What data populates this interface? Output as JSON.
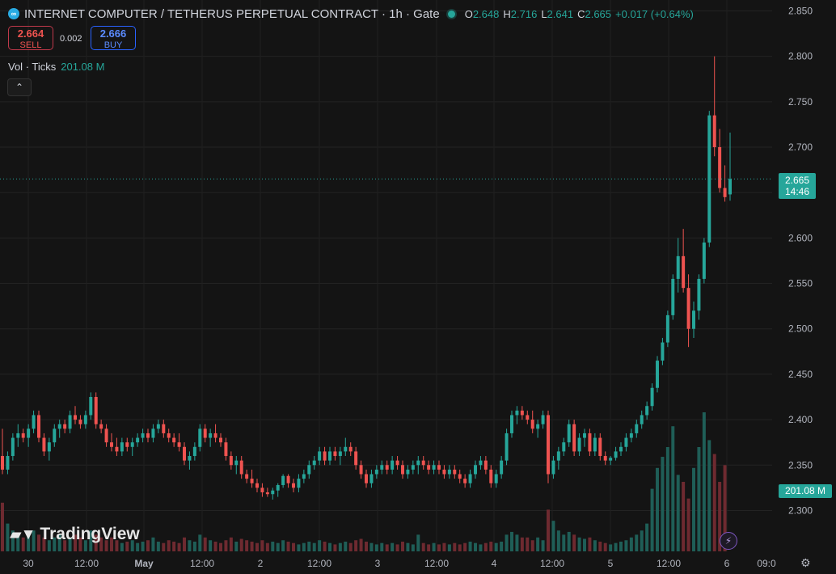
{
  "header": {
    "symbol_icon": "infinity-icon",
    "title": "INTERNET COMPUTER / TETHERUS PERPETUAL CONTRACT · 1h · Gate",
    "ohlc": [
      {
        "k": "O",
        "v": "2.648"
      },
      {
        "k": "H",
        "v": "2.716"
      },
      {
        "k": "L",
        "v": "2.641"
      },
      {
        "k": "C",
        "v": "2.665"
      },
      {
        "k": "",
        "v": "+0.017 (+0.64%)"
      }
    ]
  },
  "trade": {
    "sell_price": "2.664",
    "sell_label": "SELL",
    "spread": "0.002",
    "buy_price": "2.666",
    "buy_label": "BUY"
  },
  "volume_legend": {
    "label": "Vol · Ticks",
    "value": "201.08 M"
  },
  "collapse_icon": "chevron-up-icon",
  "price_label": {
    "price": "2.665",
    "countdown": "14:46"
  },
  "volume_label": "201.08 M",
  "brand": "TradingView",
  "colors": {
    "up": "#26a69a",
    "down": "#ef5350",
    "vol_up": "#1f5e57",
    "vol_down": "#6e2a30",
    "background": "#141414"
  },
  "chart_data": {
    "type": "candlestick",
    "title": "INTERNET COMPUTER / TETHERUS PERPETUAL CONTRACT · 1h · Gate",
    "y_ticks": [
      "2.850",
      "2.800",
      "2.750",
      "2.700",
      "2.650",
      "2.600",
      "2.550",
      "2.500",
      "2.450",
      "2.400",
      "2.350",
      "2.300"
    ],
    "y_range": [
      2.255,
      2.862
    ],
    "x_ticks": [
      "30",
      "12:00",
      "May",
      "12:00",
      "2",
      "12:00",
      "3",
      "12:00",
      "4",
      "12:00",
      "5",
      "12:00",
      "6",
      "09:0"
    ],
    "current_price": 2.665,
    "grid": true,
    "series": [
      {
        "name": "Vol · Ticks",
        "type": "histogram",
        "last_value": "201.08 M"
      }
    ],
    "bars": [
      [
        2.36,
        2.39,
        2.34,
        2.345
      ],
      [
        2.345,
        2.365,
        2.34,
        2.36
      ],
      [
        2.36,
        2.385,
        2.355,
        2.38
      ],
      [
        2.38,
        2.395,
        2.37,
        2.385
      ],
      [
        2.385,
        2.39,
        2.375,
        2.38
      ],
      [
        2.38,
        2.395,
        2.37,
        2.39
      ],
      [
        2.39,
        2.41,
        2.385,
        2.405
      ],
      [
        2.405,
        2.41,
        2.375,
        2.38
      ],
      [
        2.38,
        2.385,
        2.36,
        2.365
      ],
      [
        2.365,
        2.38,
        2.355,
        2.375
      ],
      [
        2.375,
        2.395,
        2.37,
        2.39
      ],
      [
        2.39,
        2.4,
        2.38,
        2.395
      ],
      [
        2.395,
        2.4,
        2.385,
        2.39
      ],
      [
        2.39,
        2.41,
        2.385,
        2.405
      ],
      [
        2.405,
        2.415,
        2.395,
        2.4
      ],
      [
        2.4,
        2.405,
        2.39,
        2.395
      ],
      [
        2.395,
        2.41,
        2.39,
        2.405
      ],
      [
        2.405,
        2.43,
        2.4,
        2.425
      ],
      [
        2.425,
        2.43,
        2.39,
        2.395
      ],
      [
        2.395,
        2.4,
        2.385,
        2.39
      ],
      [
        2.39,
        2.395,
        2.37,
        2.375
      ],
      [
        2.375,
        2.385,
        2.365,
        2.37
      ],
      [
        2.37,
        2.38,
        2.36,
        2.365
      ],
      [
        2.365,
        2.38,
        2.36,
        2.375
      ],
      [
        2.375,
        2.38,
        2.365,
        2.37
      ],
      [
        2.37,
        2.38,
        2.36,
        2.375
      ],
      [
        2.375,
        2.385,
        2.37,
        2.38
      ],
      [
        2.38,
        2.39,
        2.375,
        2.385
      ],
      [
        2.385,
        2.39,
        2.375,
        2.38
      ],
      [
        2.38,
        2.395,
        2.375,
        2.39
      ],
      [
        2.39,
        2.4,
        2.385,
        2.395
      ],
      [
        2.395,
        2.4,
        2.38,
        2.385
      ],
      [
        2.385,
        2.39,
        2.375,
        2.38
      ],
      [
        2.38,
        2.385,
        2.37,
        2.375
      ],
      [
        2.375,
        2.385,
        2.365,
        2.37
      ],
      [
        2.37,
        2.375,
        2.35,
        2.355
      ],
      [
        2.355,
        2.365,
        2.345,
        2.36
      ],
      [
        2.36,
        2.375,
        2.355,
        2.37
      ],
      [
        2.37,
        2.395,
        2.365,
        2.39
      ],
      [
        2.39,
        2.395,
        2.375,
        2.38
      ],
      [
        2.38,
        2.39,
        2.37,
        2.385
      ],
      [
        2.385,
        2.395,
        2.375,
        2.38
      ],
      [
        2.38,
        2.385,
        2.37,
        2.375
      ],
      [
        2.375,
        2.38,
        2.355,
        2.36
      ],
      [
        2.36,
        2.365,
        2.345,
        2.35
      ],
      [
        2.35,
        2.36,
        2.34,
        2.355
      ],
      [
        2.355,
        2.36,
        2.335,
        2.34
      ],
      [
        2.34,
        2.345,
        2.33,
        2.335
      ],
      [
        2.335,
        2.345,
        2.325,
        2.33
      ],
      [
        2.33,
        2.335,
        2.32,
        2.325
      ],
      [
        2.325,
        2.33,
        2.315,
        2.32
      ],
      [
        2.32,
        2.325,
        2.315,
        2.318
      ],
      [
        2.318,
        2.325,
        2.312,
        2.322
      ],
      [
        2.322,
        2.33,
        2.315,
        2.328
      ],
      [
        2.328,
        2.34,
        2.325,
        2.338
      ],
      [
        2.338,
        2.34,
        2.325,
        2.33
      ],
      [
        2.33,
        2.335,
        2.32,
        2.325
      ],
      [
        2.325,
        2.34,
        2.32,
        2.335
      ],
      [
        2.335,
        2.345,
        2.33,
        2.34
      ],
      [
        2.34,
        2.355,
        2.335,
        2.35
      ],
      [
        2.35,
        2.36,
        2.345,
        2.355
      ],
      [
        2.355,
        2.37,
        2.35,
        2.365
      ],
      [
        2.365,
        2.37,
        2.35,
        2.355
      ],
      [
        2.355,
        2.37,
        2.35,
        2.365
      ],
      [
        2.365,
        2.37,
        2.355,
        2.36
      ],
      [
        2.36,
        2.37,
        2.35,
        2.365
      ],
      [
        2.365,
        2.38,
        2.36,
        2.37
      ],
      [
        2.37,
        2.375,
        2.36,
        2.365
      ],
      [
        2.365,
        2.37,
        2.345,
        2.35
      ],
      [
        2.35,
        2.355,
        2.335,
        2.34
      ],
      [
        2.34,
        2.345,
        2.325,
        2.33
      ],
      [
        2.33,
        2.345,
        2.325,
        2.34
      ],
      [
        2.34,
        2.35,
        2.335,
        2.345
      ],
      [
        2.345,
        2.355,
        2.34,
        2.35
      ],
      [
        2.35,
        2.355,
        2.34,
        2.345
      ],
      [
        2.345,
        2.36,
        2.34,
        2.355
      ],
      [
        2.355,
        2.36,
        2.345,
        2.35
      ],
      [
        2.35,
        2.355,
        2.335,
        2.34
      ],
      [
        2.34,
        2.35,
        2.335,
        2.345
      ],
      [
        2.345,
        2.355,
        2.34,
        2.35
      ],
      [
        2.35,
        2.36,
        2.34,
        2.355
      ],
      [
        2.355,
        2.36,
        2.345,
        2.35
      ],
      [
        2.35,
        2.355,
        2.34,
        2.345
      ],
      [
        2.345,
        2.355,
        2.34,
        2.35
      ],
      [
        2.35,
        2.355,
        2.34,
        2.345
      ],
      [
        2.345,
        2.35,
        2.335,
        2.34
      ],
      [
        2.34,
        2.35,
        2.335,
        2.345
      ],
      [
        2.345,
        2.35,
        2.335,
        2.34
      ],
      [
        2.34,
        2.345,
        2.33,
        2.335
      ],
      [
        2.335,
        2.34,
        2.325,
        2.33
      ],
      [
        2.33,
        2.345,
        2.325,
        2.34
      ],
      [
        2.34,
        2.355,
        2.335,
        2.35
      ],
      [
        2.35,
        2.36,
        2.345,
        2.355
      ],
      [
        2.355,
        2.36,
        2.34,
        2.345
      ],
      [
        2.345,
        2.35,
        2.325,
        2.33
      ],
      [
        2.33,
        2.345,
        2.325,
        2.34
      ],
      [
        2.34,
        2.36,
        2.335,
        2.355
      ],
      [
        2.355,
        2.39,
        2.35,
        2.385
      ],
      [
        2.385,
        2.41,
        2.38,
        2.405
      ],
      [
        2.405,
        2.415,
        2.395,
        2.41
      ],
      [
        2.41,
        2.415,
        2.4,
        2.405
      ],
      [
        2.405,
        2.41,
        2.395,
        2.4
      ],
      [
        2.4,
        2.41,
        2.385,
        2.39
      ],
      [
        2.39,
        2.4,
        2.38,
        2.395
      ],
      [
        2.395,
        2.41,
        2.39,
        2.405
      ],
      [
        2.405,
        2.41,
        2.33,
        2.34
      ],
      [
        2.34,
        2.36,
        2.335,
        2.355
      ],
      [
        2.355,
        2.37,
        2.345,
        2.365
      ],
      [
        2.365,
        2.38,
        2.36,
        2.375
      ],
      [
        2.375,
        2.4,
        2.37,
        2.395
      ],
      [
        2.395,
        2.4,
        2.36,
        2.365
      ],
      [
        2.365,
        2.385,
        2.36,
        2.38
      ],
      [
        2.38,
        2.39,
        2.37,
        2.385
      ],
      [
        2.385,
        2.39,
        2.36,
        2.365
      ],
      [
        2.365,
        2.385,
        2.36,
        2.38
      ],
      [
        2.38,
        2.385,
        2.355,
        2.36
      ],
      [
        2.36,
        2.365,
        2.35,
        2.355
      ],
      [
        2.355,
        2.36,
        2.35,
        2.358
      ],
      [
        2.358,
        2.37,
        2.355,
        2.365
      ],
      [
        2.365,
        2.375,
        2.36,
        2.37
      ],
      [
        2.37,
        2.385,
        2.365,
        2.38
      ],
      [
        2.38,
        2.39,
        2.375,
        2.385
      ],
      [
        2.385,
        2.4,
        2.38,
        2.395
      ],
      [
        2.395,
        2.41,
        2.39,
        2.405
      ],
      [
        2.405,
        2.42,
        2.4,
        2.415
      ],
      [
        2.415,
        2.44,
        2.41,
        2.435
      ],
      [
        2.435,
        2.47,
        2.43,
        2.465
      ],
      [
        2.465,
        2.49,
        2.46,
        2.485
      ],
      [
        2.485,
        2.52,
        2.48,
        2.515
      ],
      [
        2.515,
        2.56,
        2.51,
        2.555
      ],
      [
        2.555,
        2.6,
        2.54,
        2.58
      ],
      [
        2.58,
        2.61,
        2.54,
        2.545
      ],
      [
        2.545,
        2.56,
        2.48,
        2.5
      ],
      [
        2.5,
        2.53,
        2.49,
        2.52
      ],
      [
        2.52,
        2.56,
        2.51,
        2.555
      ],
      [
        2.555,
        2.6,
        2.55,
        2.595
      ],
      [
        2.595,
        2.74,
        2.59,
        2.735
      ],
      [
        2.735,
        2.8,
        2.69,
        2.7
      ],
      [
        2.7,
        2.72,
        2.65,
        2.655
      ],
      [
        2.655,
        2.68,
        2.64,
        2.645
      ],
      [
        2.648,
        2.716,
        2.641,
        2.665
      ]
    ],
    "volume": [
      0.35,
      0.2,
      0.15,
      0.12,
      0.1,
      0.12,
      0.15,
      0.12,
      0.1,
      0.08,
      0.1,
      0.12,
      0.08,
      0.1,
      0.12,
      0.1,
      0.08,
      0.15,
      0.12,
      0.1,
      0.08,
      0.1,
      0.08,
      0.06,
      0.07,
      0.08,
      0.06,
      0.07,
      0.08,
      0.1,
      0.07,
      0.06,
      0.08,
      0.07,
      0.06,
      0.1,
      0.08,
      0.07,
      0.12,
      0.1,
      0.08,
      0.07,
      0.06,
      0.08,
      0.1,
      0.07,
      0.09,
      0.08,
      0.07,
      0.06,
      0.08,
      0.06,
      0.07,
      0.06,
      0.08,
      0.07,
      0.06,
      0.05,
      0.06,
      0.07,
      0.06,
      0.08,
      0.07,
      0.06,
      0.05,
      0.06,
      0.07,
      0.06,
      0.08,
      0.09,
      0.07,
      0.06,
      0.05,
      0.06,
      0.05,
      0.06,
      0.05,
      0.07,
      0.06,
      0.05,
      0.12,
      0.06,
      0.05,
      0.06,
      0.05,
      0.06,
      0.05,
      0.06,
      0.05,
      0.06,
      0.07,
      0.06,
      0.05,
      0.06,
      0.07,
      0.06,
      0.07,
      0.12,
      0.14,
      0.12,
      0.1,
      0.1,
      0.08,
      0.1,
      0.08,
      0.3,
      0.22,
      0.15,
      0.12,
      0.14,
      0.12,
      0.1,
      0.09,
      0.1,
      0.08,
      0.07,
      0.06,
      0.05,
      0.06,
      0.07,
      0.08,
      0.1,
      0.12,
      0.15,
      0.2,
      0.45,
      0.6,
      0.68,
      0.75,
      0.9,
      0.55,
      0.5,
      0.38,
      0.6,
      0.75,
      1.0,
      0.8,
      0.7,
      0.5,
      0.62
    ]
  }
}
